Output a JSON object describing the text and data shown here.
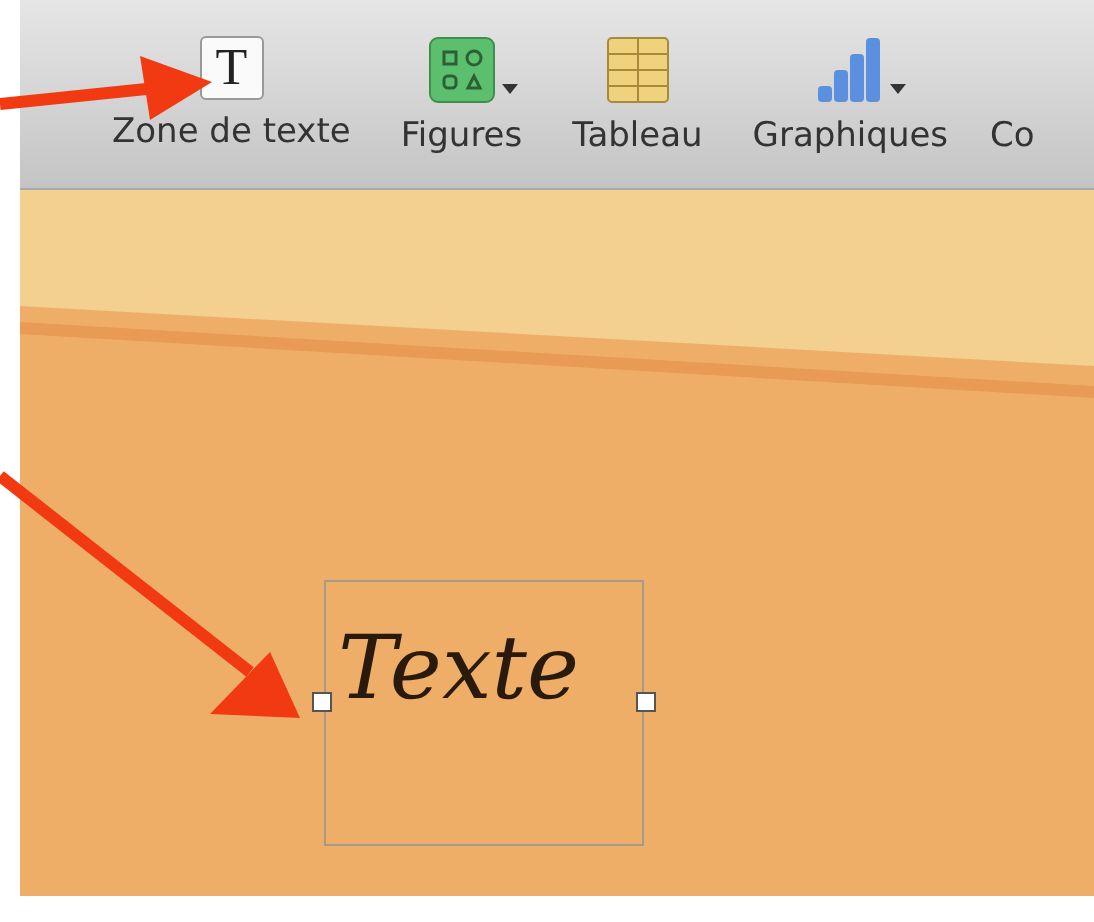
{
  "toolbar": {
    "items": [
      {
        "kind": "text",
        "label": "Zone de texte",
        "glyph": "T",
        "has_menu": false
      },
      {
        "kind": "shapes",
        "label": "Figures",
        "has_menu": true
      },
      {
        "kind": "table",
        "label": "Tableau",
        "has_menu": false
      },
      {
        "kind": "chart",
        "label": "Graphiques",
        "has_menu": true
      },
      {
        "kind": "cut",
        "label": "Co"
      }
    ]
  },
  "slide": {
    "text_box": {
      "text": "Texte",
      "selected": true
    }
  }
}
